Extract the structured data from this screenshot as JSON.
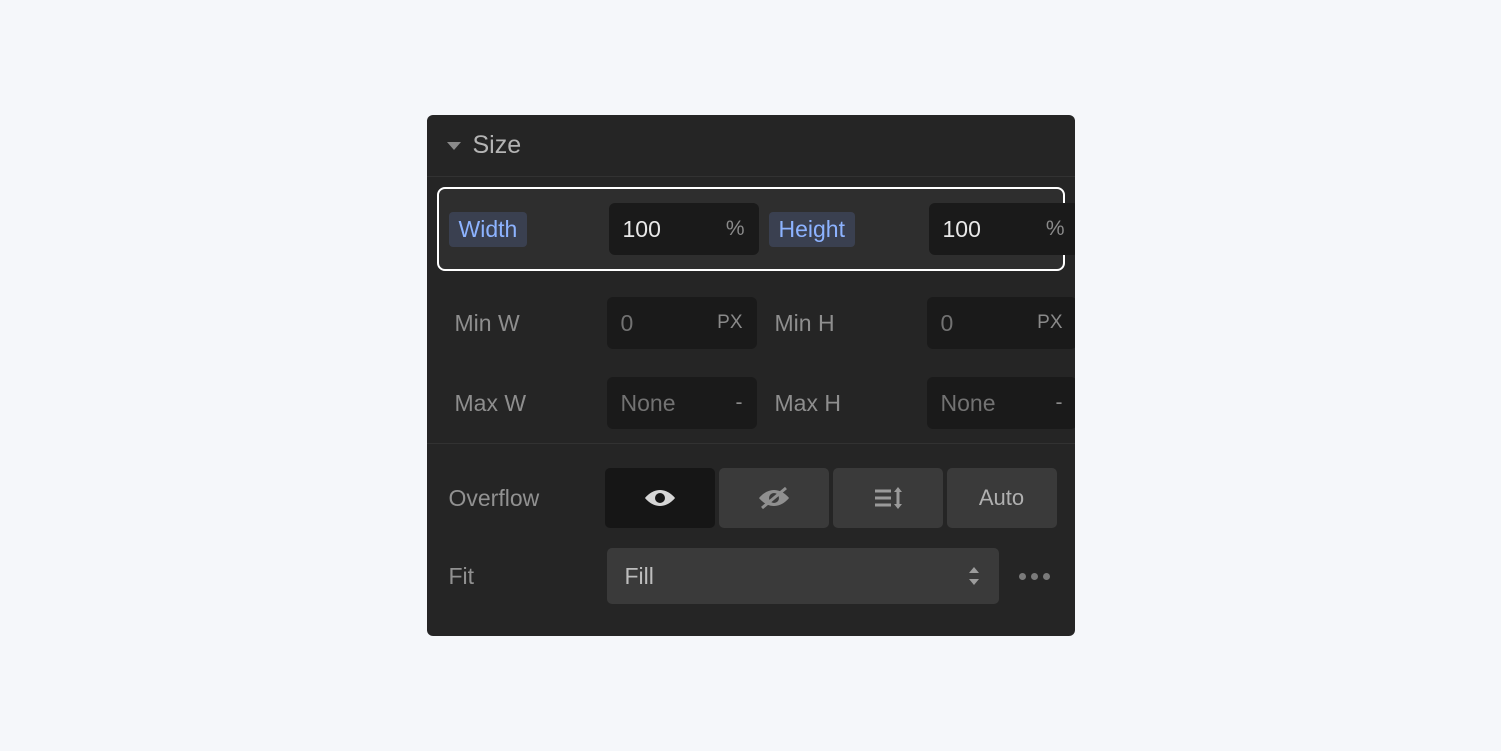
{
  "section": {
    "title": "Size"
  },
  "width": {
    "label": "Width",
    "value": "100",
    "unit": "%"
  },
  "height": {
    "label": "Height",
    "value": "100",
    "unit": "%"
  },
  "minw": {
    "label": "Min W",
    "placeholder": "0",
    "unit": "PX"
  },
  "minh": {
    "label": "Min H",
    "placeholder": "0",
    "unit": "PX"
  },
  "maxw": {
    "label": "Max W",
    "placeholder": "None",
    "unit": "-"
  },
  "maxh": {
    "label": "Max H",
    "placeholder": "None",
    "unit": "-"
  },
  "overflow": {
    "label": "Overflow",
    "auto_label": "Auto"
  },
  "fit": {
    "label": "Fit",
    "value": "Fill"
  }
}
